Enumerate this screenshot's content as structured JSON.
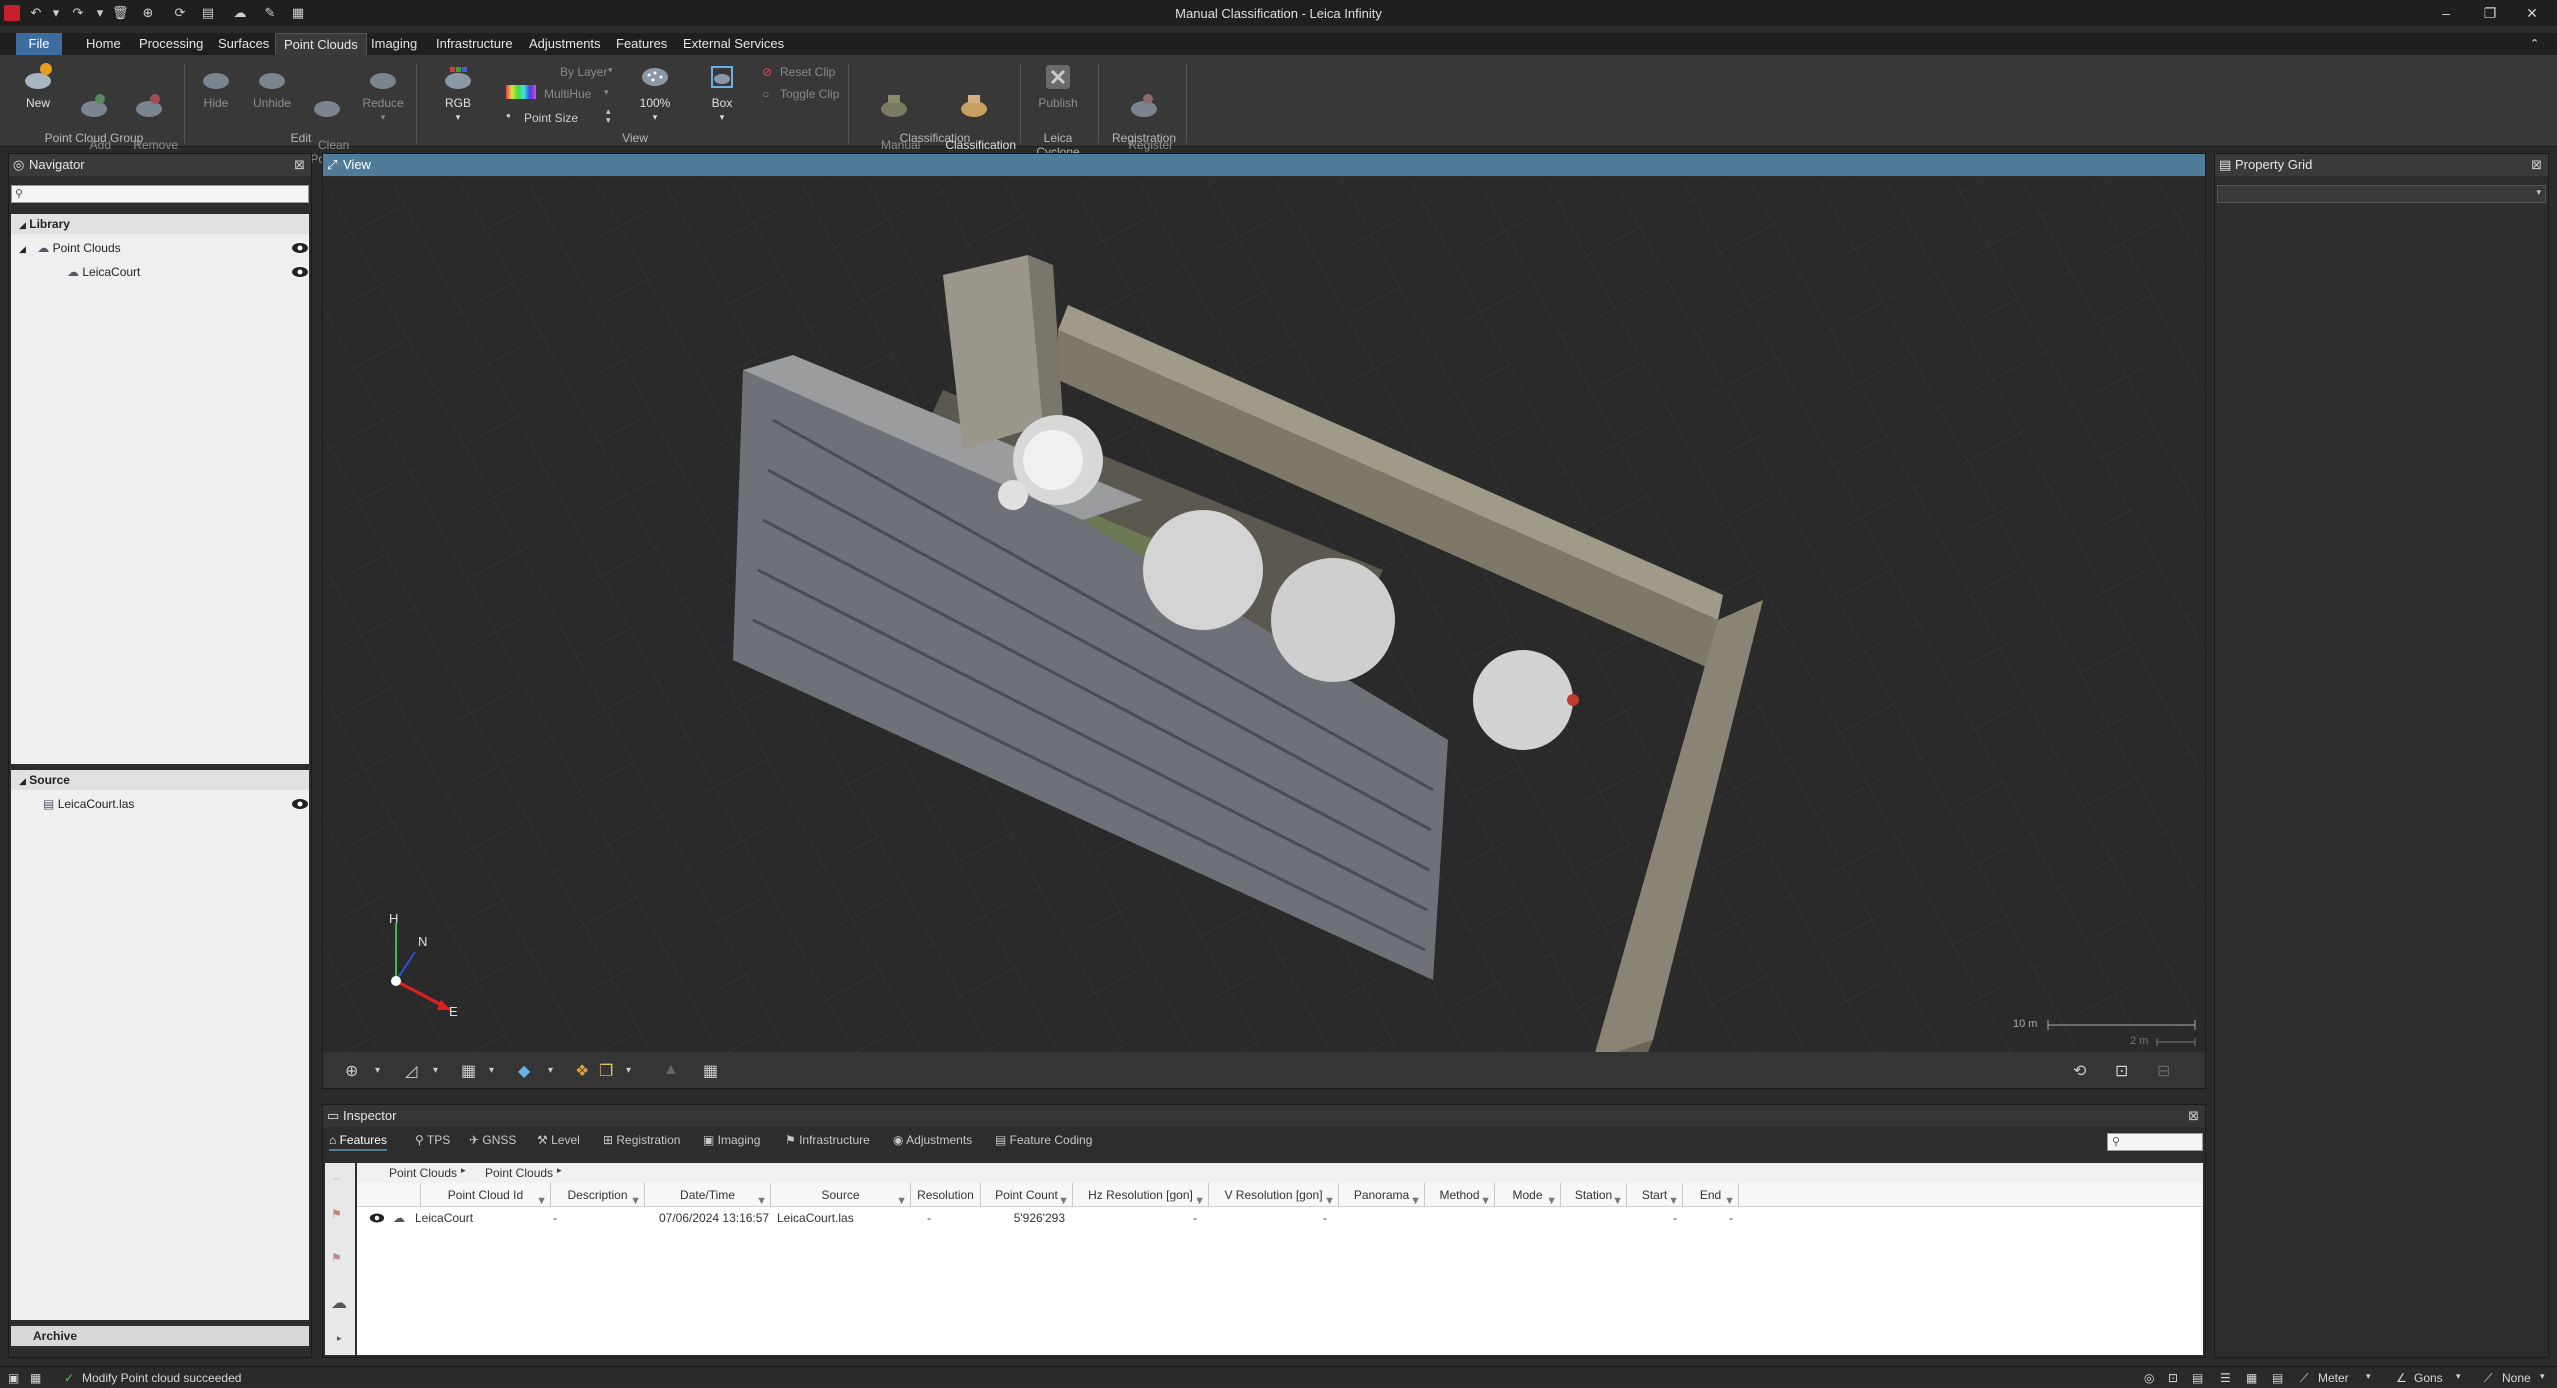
{
  "window": {
    "title": "Manual Classification - Leica Infinity"
  },
  "menu": {
    "tabs": [
      "File",
      "Home",
      "Processing",
      "Surfaces",
      "Point Clouds",
      "Imaging",
      "Infrastructure",
      "Adjustments",
      "Features",
      "External Services"
    ],
    "active": "Point Clouds"
  },
  "ribbon": {
    "new": "New",
    "add_to": "Add\nTo",
    "remove_from": "Remove\nFrom",
    "group_point_cloud": "Point Cloud Group",
    "hide": "Hide",
    "unhide": "Unhide",
    "clean_points": "Clean\nPoints",
    "reduce": "Reduce",
    "group_edit": "Edit",
    "rgb": "RGB",
    "by_layer": "By Layer",
    "multihue": "MultiHue",
    "point_size": "Point Size",
    "percent": "100%",
    "box": "Box",
    "reset_clip": "Reset Clip",
    "toggle_clip": "Toggle Clip",
    "group_view": "View",
    "manual_classification": "Manual\nClassification",
    "classification_manager": "Classification\nManager",
    "group_classification": "Classification",
    "publish": "Publish",
    "group_cyclone": "Leica Cyclone",
    "register_tool": "Register\nTool",
    "group_registration": "Registration"
  },
  "navigator": {
    "title": "Navigator",
    "library_label": "Library",
    "point_clouds_label": "Point Clouds",
    "leicacourt_label": "LeicaCourt",
    "source_label": "Source",
    "source_file": "LeicaCourt.las",
    "archive_label": "Archive"
  },
  "view": {
    "title": "View",
    "axis_h": "H",
    "axis_n": "N",
    "axis_e": "E",
    "scale_10m": "10 m",
    "scale_2m": "2 m"
  },
  "property_grid": {
    "title": "Property Grid"
  },
  "inspector": {
    "title": "Inspector",
    "tabs": [
      "Features",
      "TPS",
      "GNSS",
      "Level",
      "Registration",
      "Imaging",
      "Infrastructure",
      "Adjustments",
      "Feature Coding"
    ],
    "breadcrumb": [
      "Point Clouds",
      "Point Clouds"
    ],
    "columns": [
      "Point Cloud Id",
      "Description",
      "Date/Time",
      "Source",
      "Resolution",
      "Point Count",
      "Hz Resolution [gon]",
      "V Resolution [gon]",
      "Panorama",
      "Method",
      "Mode",
      "Station",
      "Start",
      "End"
    ],
    "rows": [
      {
        "id": "LeicaCourt",
        "description": "-",
        "datetime": "07/06/2024 13:16:57",
        "source": "LeicaCourt.las",
        "resolution": "-",
        "point_count": "5'926'293",
        "hz_res": "-",
        "v_res": "-",
        "panorama": "",
        "method": "",
        "mode": "",
        "station": "",
        "start": "-",
        "end": "-"
      }
    ]
  },
  "status": {
    "message": "Modify Point cloud succeeded",
    "unit": "Meter",
    "angle": "Gons",
    "none": "None"
  },
  "colors": {
    "accent": "#4e7c99",
    "file_tab": "#3c6d9e",
    "background": "#2b2b2b"
  }
}
